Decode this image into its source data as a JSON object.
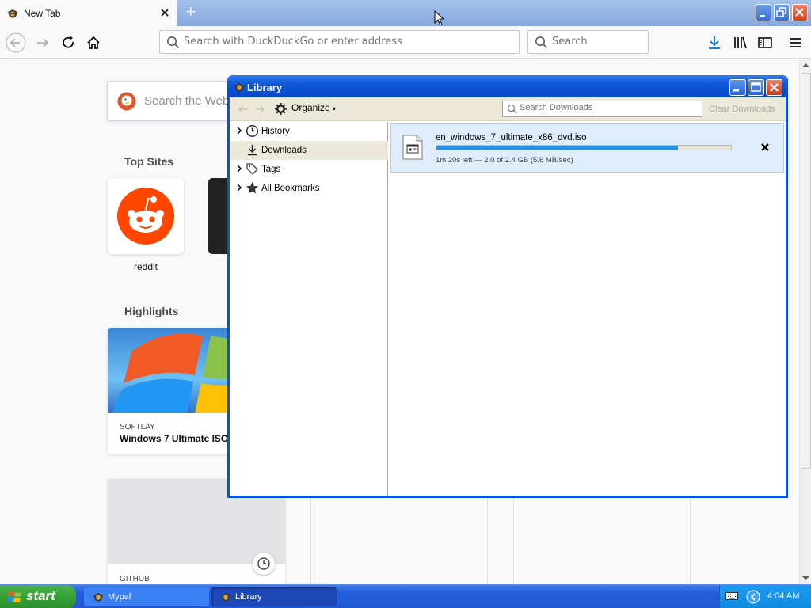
{
  "browser": {
    "tab_title": "New Tab",
    "new_tab_symbol": "+",
    "url_placeholder": "Search with DuckDuckGo or enter address",
    "search_placeholder": "Search"
  },
  "newtab": {
    "search_placeholder": "Search the Web",
    "top_sites_title": "Top Sites",
    "top_sites": [
      {
        "label": "reddit"
      }
    ],
    "highlights_title": "Highlights",
    "highlights": [
      {
        "source": "SOFTLAY",
        "title": "Windows 7 Ultimate ISO"
      },
      {
        "source": "GITHUB",
        "title": ""
      }
    ]
  },
  "library": {
    "title": "Library",
    "organize_label": "Organize",
    "search_placeholder": "Search Downloads",
    "clear_label": "Clear Downloads",
    "tree": [
      {
        "label": "History",
        "icon": "clock-icon",
        "expandable": true
      },
      {
        "label": "Downloads",
        "icon": "download-icon",
        "expandable": false,
        "selected": true
      },
      {
        "label": "Tags",
        "icon": "tag-icon",
        "expandable": true
      },
      {
        "label": "All Bookmarks",
        "icon": "star-icon",
        "expandable": true
      }
    ],
    "download": {
      "filename": "en_windows_7_ultimate_x86_dvd.iso",
      "status": "1m 20s left — 2.0 of 2.4 GB (5.6 MB/sec)",
      "progress": 0.82
    }
  },
  "taskbar": {
    "start_label": "start",
    "tasks": [
      {
        "label": "Mypal",
        "active": false
      },
      {
        "label": "Library",
        "active": true
      }
    ],
    "clock": "4:04 AM"
  },
  "colors": {
    "xp_blue": "#0a53d9",
    "progress": "#2a90e0",
    "start_green": "#36a136",
    "reddit": "#ff4500"
  }
}
